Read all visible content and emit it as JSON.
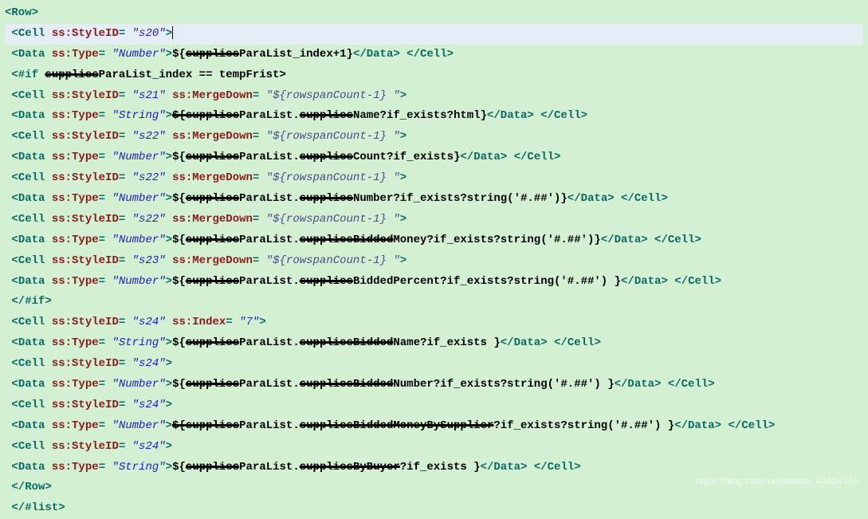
{
  "lines": [
    {
      "key": "l0",
      "hl": false
    },
    {
      "key": "l1",
      "hl": true
    },
    {
      "key": "l2",
      "hl": false
    },
    {
      "key": "l3",
      "hl": false
    },
    {
      "key": "l4",
      "hl": false
    },
    {
      "key": "l5",
      "hl": false
    },
    {
      "key": "l6",
      "hl": false
    },
    {
      "key": "l7",
      "hl": false
    },
    {
      "key": "l8",
      "hl": false
    },
    {
      "key": "l9",
      "hl": false
    },
    {
      "key": "l10",
      "hl": false
    },
    {
      "key": "l11",
      "hl": false
    },
    {
      "key": "l12",
      "hl": false
    },
    {
      "key": "l13",
      "hl": false
    },
    {
      "key": "l14",
      "hl": false
    },
    {
      "key": "l15",
      "hl": false
    },
    {
      "key": "l16",
      "hl": false
    },
    {
      "key": "l17",
      "hl": false
    },
    {
      "key": "l18",
      "hl": false
    },
    {
      "key": "l19",
      "hl": false
    },
    {
      "key": "l20",
      "hl": false
    },
    {
      "key": "l21",
      "hl": false
    },
    {
      "key": "l22",
      "hl": false
    },
    {
      "key": "l23",
      "hl": false
    }
  ],
  "t": {
    "rowOpen": "<Row>",
    "cell": "Cell",
    "data": "Data",
    "row": "Row",
    "ifOpen": "<#if ",
    "ifClose": "</#if>",
    "listClose": "</#list>",
    "ssStyleID": "ss:StyleID",
    "ssType": "ss:Type",
    "ssMergeDown": "ss:MergeDown",
    "ssIndex": "ss:Index",
    "s20": "\"s20\"",
    "s21": "\"s21\"",
    "s22": "\"s22\"",
    "s23": "\"s23\"",
    "s24": "\"s24\"",
    "seven": "\"7\"",
    "tNumber": "\"Number\"",
    "tString": "\"String\"",
    "mergeExpr": "\"${rowspanCount-1} \"",
    "redactA": "supplies",
    "redactB": "supplies",
    "redactBidded": "suppliesBidded",
    "redactBiddedName": "suppliesBidded",
    "redactBiddedNum": "suppliesBidded",
    "redactMoneyBySupplier": "suppliesBiddedMoneyBySupplier",
    "redactByBuyer": "suppliesByBuyer",
    "txt_index1": "ParaList_index+1}",
    "txt_ifcond": "ParaList_index == tempFrist>",
    "txt_name": "Name?if_exists?html}",
    "txt_count": "Count?if_exists}",
    "txt_number": "Number?if_exists?string('#.##')}",
    "txt_money": "Money?if_exists?string('#.##')}",
    "txt_percent": "BiddedPercent?if_exists?string('#.##') }",
    "txt_bname": "Name?if_exists }",
    "txt_bnumber": "Number?if_exists?string('#.##') }",
    "txt_bmoney": "?if_exists?string('#.##') }",
    "txt_buyer": "?if_exists }",
    "txt_paralist": "ParaList.",
    "open_dollar": "${",
    "open_dollar_strike": "${",
    "close_angle": ">",
    "lt": "<",
    "ltSlash": "</",
    "eq": "=",
    "sp": " "
  },
  "watermark": "https://blog.csdn.net/weixin_43454365"
}
